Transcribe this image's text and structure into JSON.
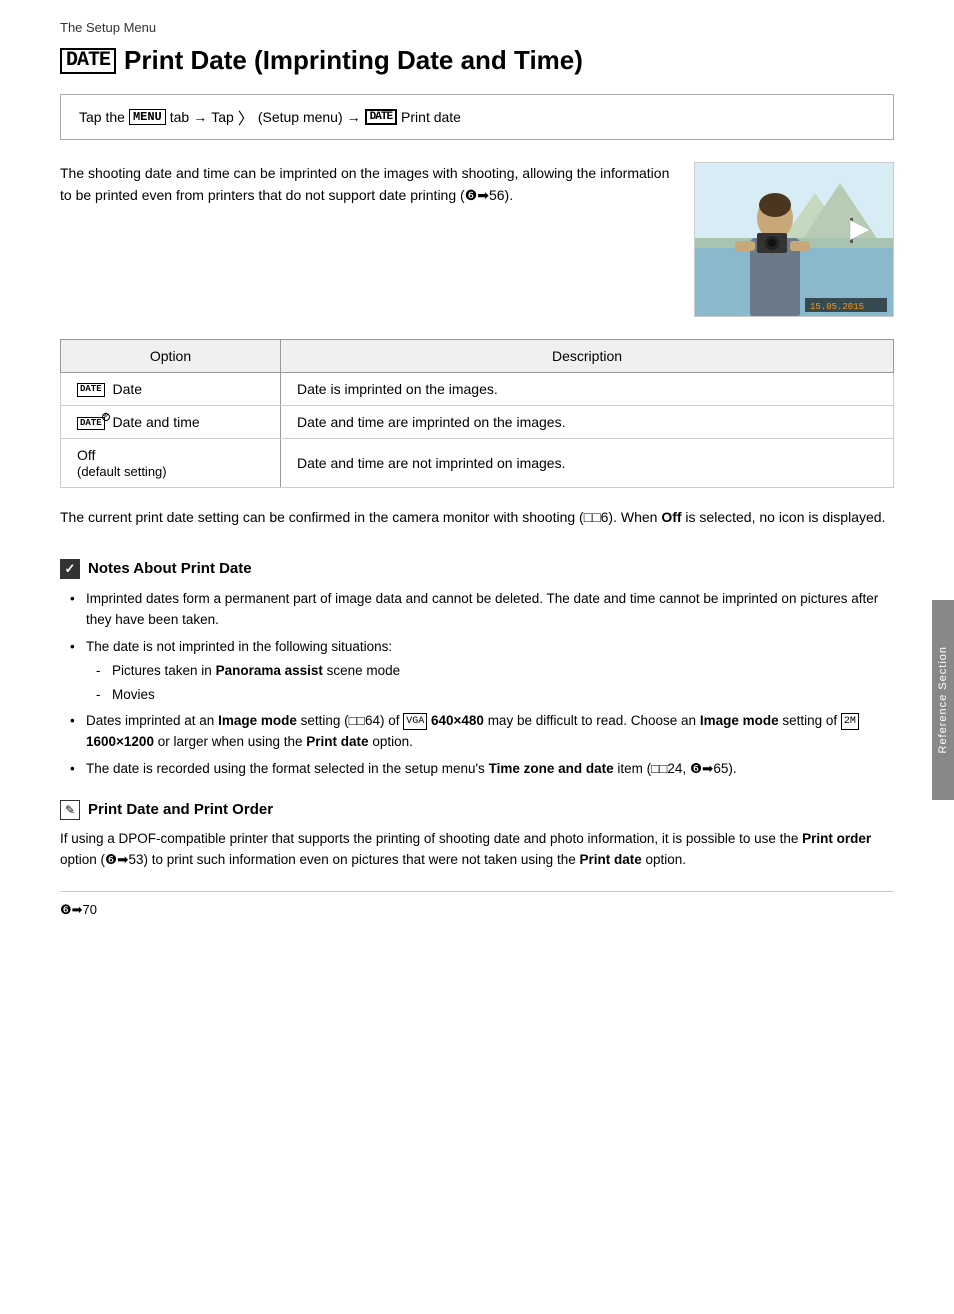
{
  "page": {
    "setup_menu_label": "The Setup Menu",
    "title": "Print Date (Imprinting Date and Time)",
    "title_icon": "DATE",
    "nav_instruction": {
      "text": "Tap the  tab  Tap  (Setup menu)   Print date",
      "menu_tag": "MENU",
      "setup_icon": "Y",
      "date_tag": "DATE"
    },
    "intro_text": "The shooting date and time can be imprinted on the images with shooting, allowing the information to be printed even from printers that do not support date printing (",
    "intro_ref": "❻➡56",
    "intro_text2": ").",
    "table": {
      "col1_header": "Option",
      "col2_header": "Description",
      "rows": [
        {
          "option_icon": "DATE",
          "option_label": "Date",
          "description": "Date is imprinted on the images."
        },
        {
          "option_icon": "DATE",
          "option_label": "Date and time",
          "description": "Date and time are imprinted on the images.",
          "has_clock": true
        },
        {
          "option_label": "Off",
          "option_sub": "(default setting)",
          "description": "Date and time are not imprinted on images."
        }
      ]
    },
    "confirm_text": "The current print date setting can be confirmed in the camera monitor with shooting (",
    "confirm_ref": "❏❏6",
    "confirm_text2": "). When ",
    "confirm_bold": "Off",
    "confirm_text3": " is selected, no icon is displayed.",
    "side_tab": "Reference Section",
    "notes": {
      "title": "Notes About Print Date",
      "bullets": [
        "Imprinted dates form a permanent part of image data and cannot be deleted. The date and time cannot be imprinted on pictures after they have been taken.",
        "The date is not imprinted in the following situations:",
        "Dates imprinted at an Image mode setting (",
        "The date is recorded using the format selected in the setup menu's Time zone and date item ("
      ],
      "sub_items": [
        "Pictures taken in Panorama assist scene mode",
        "Movies"
      ],
      "bullet3_parts": {
        "pre": "Dates imprinted at an ",
        "bold1": "Image mode",
        "mid1": " setting (",
        "ref1": "❏❏64",
        "mid2": ") of ",
        "vga": "VGA",
        "bold2": " 640×480",
        "mid3": " may be difficult to read. Choose an ",
        "bold3": "Image mode",
        "mid4": " setting of ",
        "img2": "2M",
        "bold4": " 1600×1200",
        "mid5": " or larger when using the ",
        "bold5": "Print date",
        "end": " option."
      },
      "bullet4_parts": {
        "pre": "The date is recorded using the format selected in the setup menu's ",
        "bold": "Time zone and date",
        "mid": " item (",
        "ref1": "❏❏24",
        "sep": ", ",
        "ref2": "❻➡65",
        "end": ")."
      }
    },
    "print_order": {
      "title": "Print Date and Print Order",
      "text_parts": {
        "pre": "If using a DPOF-compatible printer that supports the printing of shooting date and photo information, it is possible to use the ",
        "bold1": "Print order",
        "mid1": " option (",
        "ref1": "❻➡53",
        "mid2": ") to print such information even on pictures that were not taken using the ",
        "bold2": "Print date",
        "end": " option."
      }
    },
    "footer": {
      "page_ref": "❻➡70"
    },
    "date_stamp": "15.05.2015"
  }
}
